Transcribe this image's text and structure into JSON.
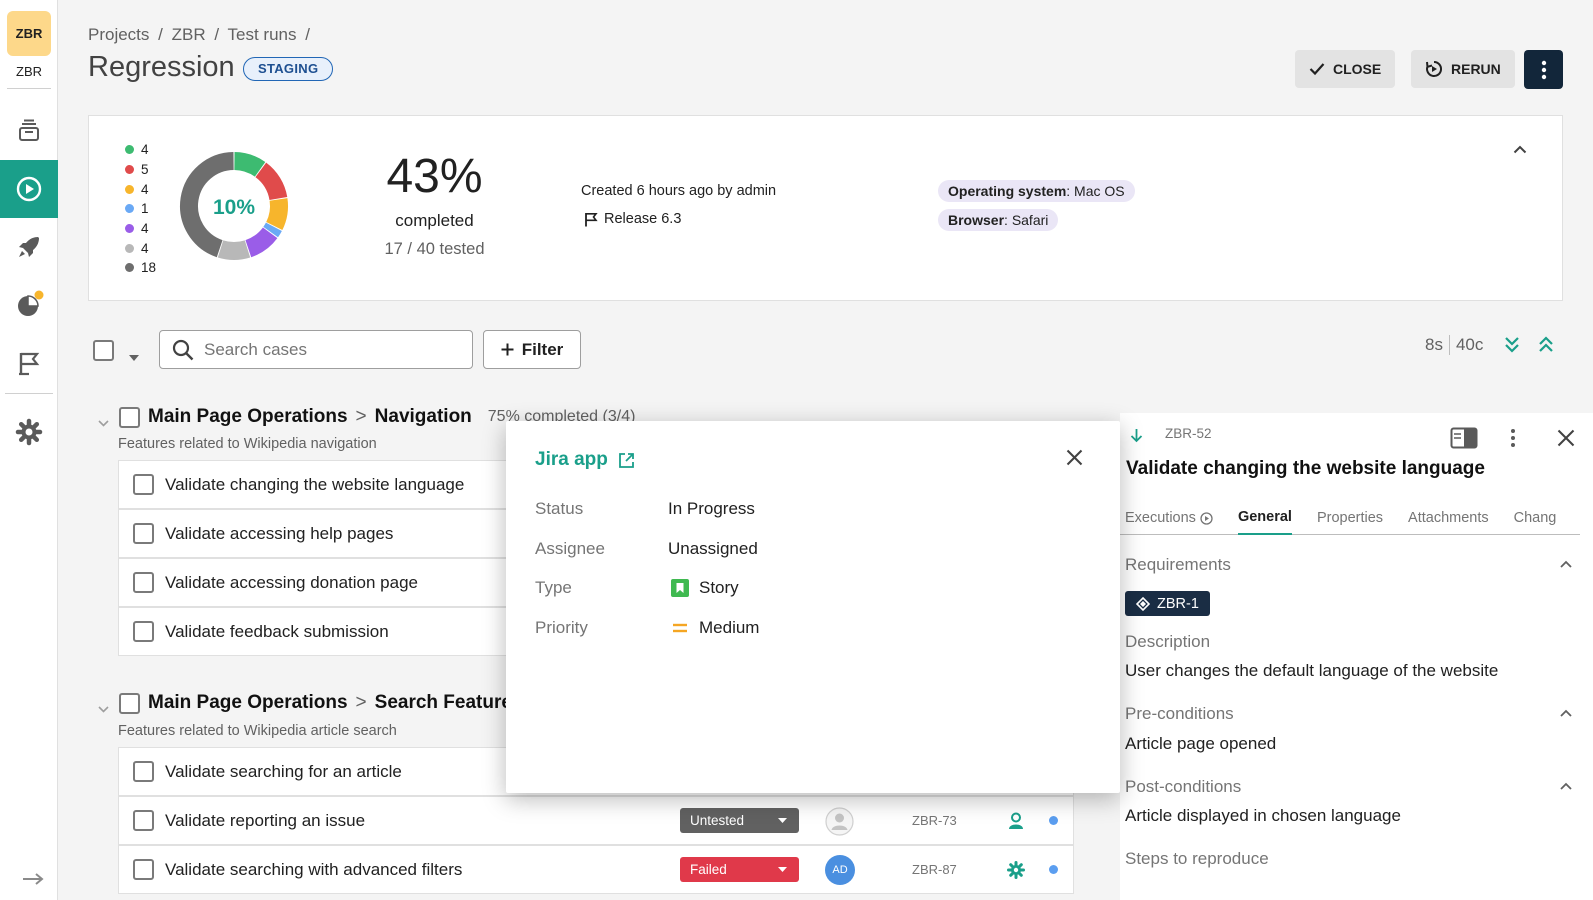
{
  "sidebar": {
    "project_badge": "ZBR",
    "project_key": "ZBR",
    "items": [
      {
        "icon": "test-cases-icon"
      },
      {
        "icon": "test-runs-icon",
        "active": true
      },
      {
        "icon": "launches-icon"
      },
      {
        "icon": "dashboards-icon",
        "notification": true
      },
      {
        "icon": "milestones-icon"
      },
      {
        "icon": "settings-icon"
      }
    ],
    "expand_icon": "expand-arrow-icon"
  },
  "header": {
    "breadcrumbs": [
      "Projects",
      "/",
      "ZBR",
      "/",
      "Test runs",
      "/"
    ],
    "title": "Regression",
    "environment": "STAGING",
    "close_label": "CLOSE",
    "rerun_label": "RERUN"
  },
  "summary": {
    "legend": [
      {
        "value": "4",
        "color": "#3dbb71"
      },
      {
        "value": "5",
        "color": "#e04b4b"
      },
      {
        "value": "4",
        "color": "#f7b52c"
      },
      {
        "value": "1",
        "color": "#6aa9f5"
      },
      {
        "value": "4",
        "color": "#9a5de8"
      },
      {
        "value": "4",
        "color": "#b8b8b8"
      },
      {
        "value": "18",
        "color": "#6e6e6e"
      }
    ],
    "donut_center": "10%",
    "completed_pct": "43%",
    "completed_label": "completed",
    "tested_label": "17 / 40 tested",
    "created": "Created 6 hours ago by admin",
    "release": "Release 6.3",
    "config": [
      {
        "key": "Operating system",
        "sep": ": ",
        "value": "Mac OS"
      },
      {
        "key": "Browser",
        "sep": ": ",
        "value": "Safari"
      }
    ]
  },
  "toolbar": {
    "search_placeholder": "Search cases",
    "filter_label": "Filter",
    "time_count": "8s",
    "case_count": "40c"
  },
  "suites": [
    {
      "parent": "Main Page Operations",
      "gt": ">",
      "name": "Navigation",
      "progress": "75% completed (3/4)",
      "description": "Features related to Wikipedia navigation",
      "cases": [
        {
          "title": "Validate changing the website language"
        },
        {
          "title": "Validate accessing help pages"
        },
        {
          "title": "Validate accessing donation page"
        },
        {
          "title": "Validate feedback submission"
        }
      ]
    },
    {
      "parent": "Main Page Operations",
      "gt": ">",
      "name": "Search Features",
      "description": "Features related to Wikipedia article search",
      "cases": [
        {
          "title": "Validate searching for an article"
        },
        {
          "title": "Validate reporting an issue",
          "status": "Untested",
          "status_color": "#616161",
          "key": "ZBR-73"
        },
        {
          "title": "Validate searching with advanced filters",
          "status": "Failed",
          "status_color": "#e0394a",
          "assignee": "AD",
          "key": "ZBR-87"
        }
      ]
    }
  ],
  "jira_popup": {
    "title": "Jira app",
    "fields": [
      {
        "label": "Status",
        "value": "In Progress"
      },
      {
        "label": "Assignee",
        "value": "Unassigned"
      },
      {
        "label": "Type",
        "value": "Story"
      },
      {
        "label": "Priority",
        "value": "Medium"
      }
    ]
  },
  "detail_panel": {
    "key": "ZBR-52",
    "title": "Validate changing the website language",
    "tabs": [
      "Executions",
      "General",
      "Properties",
      "Attachments",
      "Chang"
    ],
    "active_tab": "General",
    "requirements_label": "Requirements",
    "requirement_chip": "ZBR-1",
    "description_label": "Description",
    "description": "User changes the default language of the website",
    "preconditions_label": "Pre-conditions",
    "preconditions": "Article page opened",
    "postconditions_label": "Post-conditions",
    "postconditions": "Article displayed in chosen language",
    "steps_label": "Steps to reproduce"
  }
}
